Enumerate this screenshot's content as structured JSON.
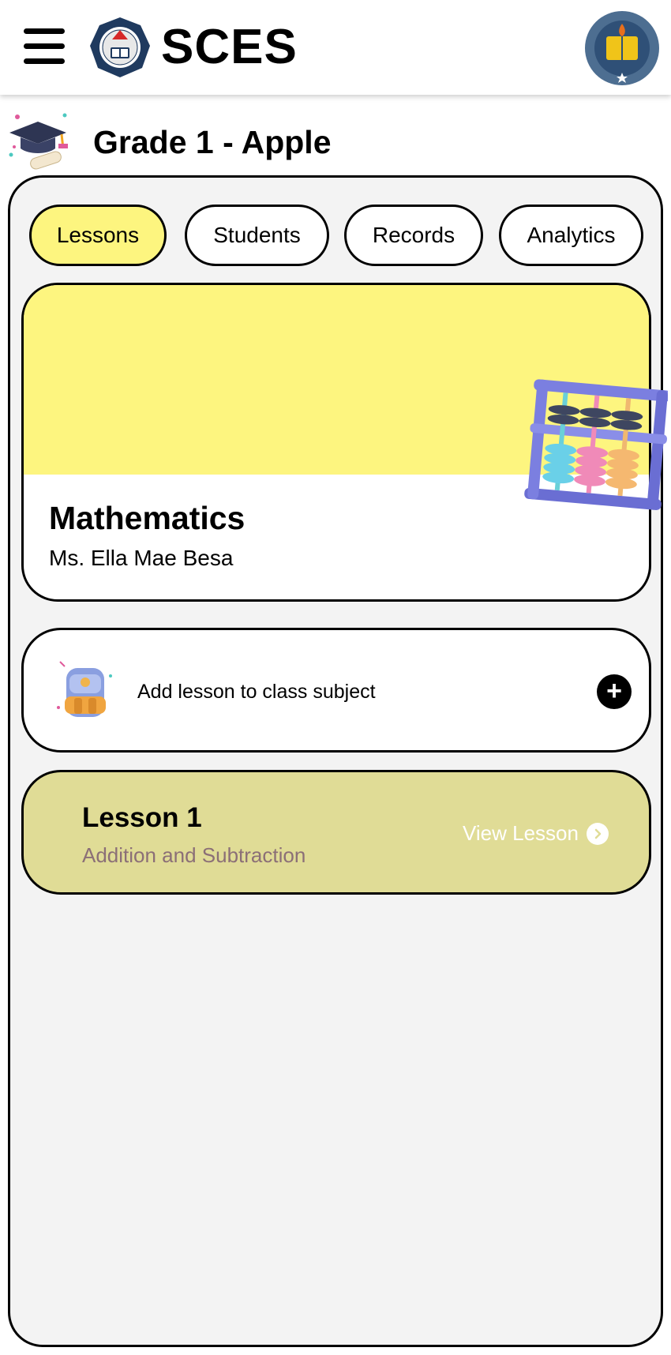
{
  "header": {
    "app_title": "SCES",
    "menu_icon": "hamburger-menu-icon",
    "school_logo": "school-seal-logo",
    "deped_logo": "deped-seal-logo"
  },
  "class_section": {
    "title": "Grade 1 - Apple",
    "icon": "graduation-cap-diploma-icon"
  },
  "tabs": [
    {
      "label": "Lessons",
      "active": true
    },
    {
      "label": "Students",
      "active": false
    },
    {
      "label": "Records",
      "active": false
    },
    {
      "label": "Analytics",
      "active": false
    }
  ],
  "subject": {
    "name": "Mathematics",
    "teacher": "Ms. Ella Mae Besa",
    "banner_color": "#fdf57f",
    "illustration": "abacus-icon"
  },
  "add_lesson": {
    "label": "Add lesson to class subject",
    "icon": "backpack-icon",
    "action_icon": "plus-icon"
  },
  "lessons": [
    {
      "title": "Lesson 1",
      "subtitle": "Addition and Subtraction",
      "action_label": "View Lesson",
      "action_icon": "chevron-right-circle-icon",
      "card_color": "#e0dc96"
    }
  ]
}
